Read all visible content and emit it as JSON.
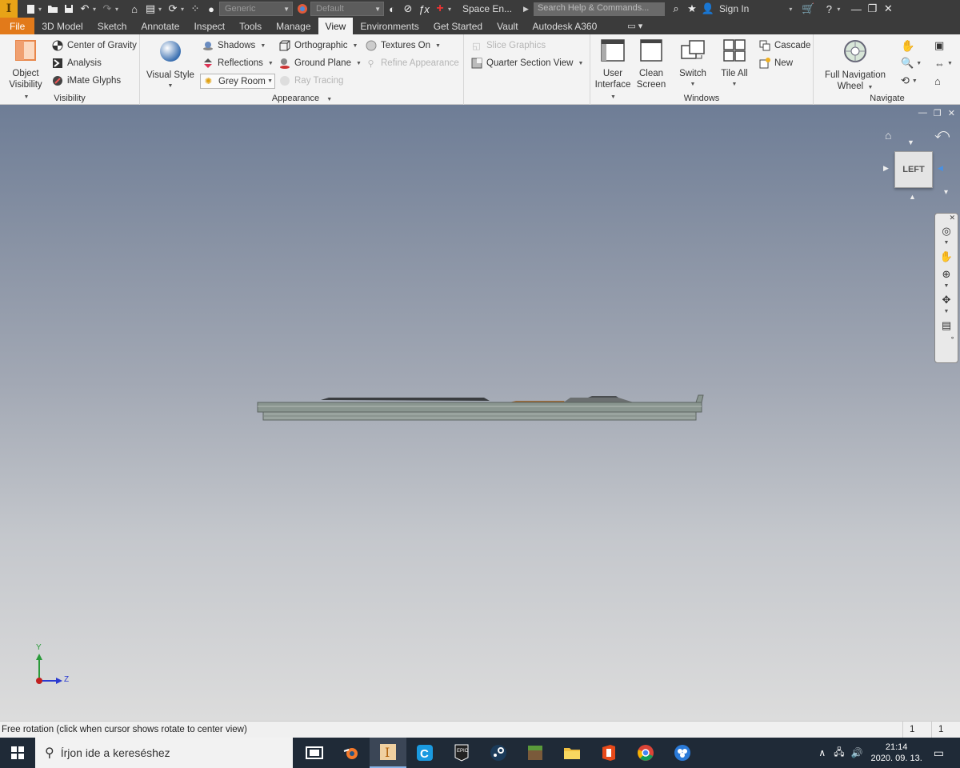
{
  "qat": {
    "style_combo": "Generic",
    "appearance_combo": "Default",
    "doc_title": "Space En...",
    "search_placeholder": "Search Help & Commands...",
    "sign_in": "Sign In"
  },
  "tabs": [
    "File",
    "3D Model",
    "Sketch",
    "Annotate",
    "Inspect",
    "Tools",
    "Manage",
    "View",
    "Environments",
    "Get Started",
    "Vault",
    "Autodesk A360"
  ],
  "active_tab": "View",
  "ribbon": {
    "visibility": {
      "title": "Visibility",
      "object_visibility": "Object Visibility",
      "center_of_gravity": "Center of Gravity",
      "analysis": "Analysis",
      "imate_glyphs": "iMate Glyphs"
    },
    "appearance": {
      "title": "Appearance",
      "visual_style": "Visual Style",
      "shadows": "Shadows",
      "reflections": "Reflections",
      "grey_room": "Grey Room",
      "orthographic": "Orthographic",
      "ground_plane": "Ground Plane",
      "ray_tracing": "Ray Tracing",
      "textures_on": "Textures On",
      "refine_appearance": "Refine Appearance",
      "slice_graphics": "Slice Graphics",
      "quarter_section_view": "Quarter Section View"
    },
    "windows": {
      "title": "Windows",
      "user_interface": "User Interface",
      "clean_screen": "Clean Screen",
      "switch": "Switch",
      "tile_all": "Tile All",
      "cascade": "Cascade",
      "new": "New"
    },
    "navigate": {
      "title": "Navigate",
      "full_navigation_wheel": "Full Navigation Wheel"
    }
  },
  "viewcube": {
    "face": "LEFT"
  },
  "triad": {
    "y": "Y",
    "z": "Z"
  },
  "status": {
    "message": "Free rotation (click when cursor shows rotate to center view)",
    "count1": "1",
    "count2": "1"
  },
  "taskbar": {
    "search_placeholder": "Írjon ide a kereséshez",
    "time": "21:14",
    "date": "2020. 09. 13."
  },
  "colors": {
    "file_tab": "#e27a1a",
    "qat_bg": "#3b3b3b",
    "taskbar_bg": "#1f2a37"
  }
}
